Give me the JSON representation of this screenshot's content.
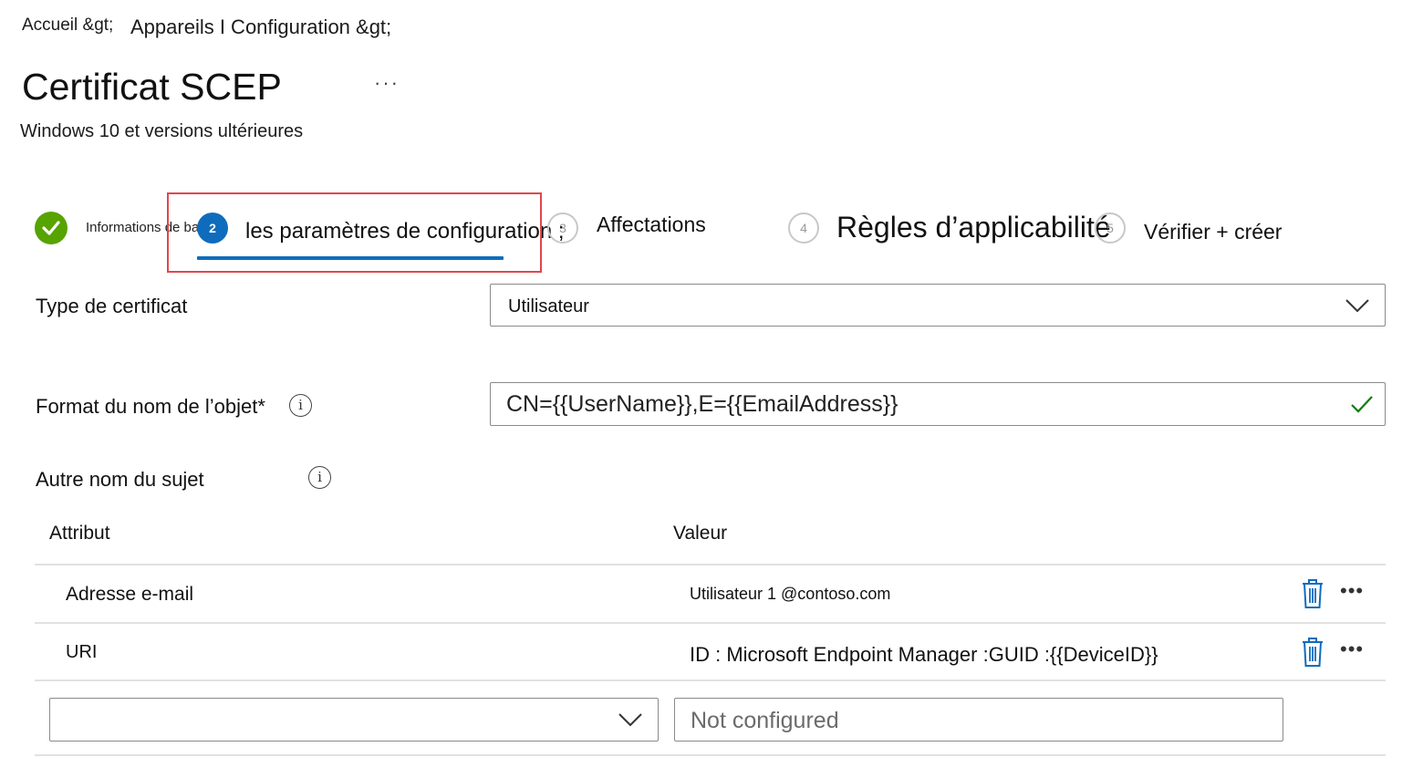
{
  "breadcrumb": {
    "home": "Accueil &gt;",
    "path": "Appareils I Configuration &gt;"
  },
  "page": {
    "title": "Certificat SCEP",
    "more": "···",
    "subtitle": "Windows 10 et versions ultérieures"
  },
  "steps": [
    {
      "number": "1",
      "label": "Informations de base",
      "state": "completed"
    },
    {
      "number": "2",
      "label": "les paramètres de configuration ;",
      "state": "current"
    },
    {
      "number": "3",
      "label": "Affectations",
      "state": "pending"
    },
    {
      "number": "4",
      "label": "Règles d’applicabilité",
      "state": "pending"
    },
    {
      "number": "5",
      "label": "Vérifier + créer",
      "state": "pending"
    }
  ],
  "form": {
    "cert_type_label": "Type de certificat",
    "cert_type_value": "Utilisateur",
    "subject_format_label": "Format du nom de l’objet*",
    "subject_format_value": "CN={{UserName}},E={{EmailAddress}}",
    "san_label": "Autre nom du sujet"
  },
  "san_table": {
    "headers": {
      "attribute": "Attribut",
      "value": "Valeur"
    },
    "rows": [
      {
        "attribute": "Adresse e-mail",
        "value": "Utilisateur 1 @contoso.com"
      },
      {
        "attribute": "URI",
        "value": "ID : Microsoft Endpoint Manager :GUID :{{DeviceID}}"
      }
    ],
    "new_row": {
      "attribute_value": "",
      "value_placeholder": "Not configured"
    },
    "row_more": "•••"
  },
  "colors": {
    "accent": "#0f6cbd",
    "success": "#57a300",
    "highlight": "#e0474c",
    "check_valid": "#107c10"
  },
  "icons": {
    "completed": "checkmark-icon",
    "info": "info-icon",
    "dropdown": "chevron-down-icon",
    "valid": "checkmark-icon",
    "delete": "trash-icon",
    "more": "more-icon"
  }
}
